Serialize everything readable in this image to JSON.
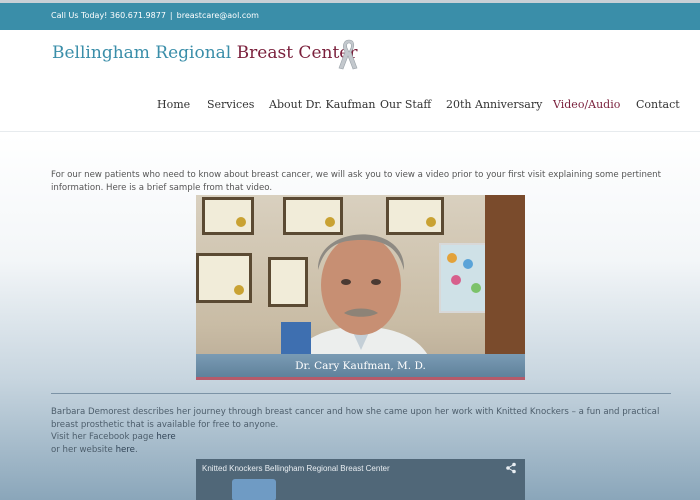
{
  "topbar": {
    "phone_text": "Call Us Today! 360.671.9877",
    "separator": "|",
    "email": "breastcare@aol.com"
  },
  "logo": {
    "part1": "Bellingham Regional",
    "part2": "Breast Center",
    "icon": "pink-ribbon-icon"
  },
  "nav": {
    "items": [
      {
        "label": "Home"
      },
      {
        "label": "Services"
      },
      {
        "label": "About Dr. Kaufman"
      },
      {
        "label": "Our Staff"
      },
      {
        "label": "20th Anniversary"
      },
      {
        "label": "Video/Audio"
      },
      {
        "label": "Contact"
      }
    ],
    "active": "Video/Audio"
  },
  "main": {
    "intro": "For our new patients who need to know about breast cancer, we will ask you to view a video prior to your first visit explaining some pertinent information. Here is a brief sample from that video.",
    "video1": {
      "caption": "Dr. Cary Kaufman, M. D."
    },
    "story_text": "Barbara Demorest describes her journey through breast cancer and how she came upon her work with Knitted Knockers – a fun and practical breast prosthetic that is available for free to anyone.",
    "facebook_prefix": "Visit her Facebook page",
    "facebook_link": "here",
    "website_prefix": "or her website",
    "website_link": "here",
    "website_suffix": ".",
    "video2": {
      "title": "Knitted Knockers Bellingham Regional Breast Center"
    }
  },
  "colors": {
    "brand_teal": "#3a8ea9",
    "brand_burgundy": "#7a1f3b"
  }
}
